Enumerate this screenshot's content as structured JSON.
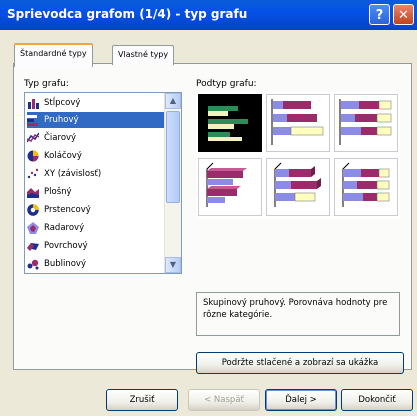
{
  "window": {
    "title": "Sprievodca grafom (1/4) - typ grafu",
    "help_label": "?",
    "close_label": "✕"
  },
  "tabs": [
    {
      "label": "Štandardné typy",
      "active": true
    },
    {
      "label": "Vlastné typy",
      "active": false
    }
  ],
  "chart_type": {
    "label": "Typ grafu:",
    "items": [
      {
        "label": "Stĺpcový",
        "icon": "column-chart-icon"
      },
      {
        "label": "Pruhový",
        "icon": "bar-chart-icon",
        "selected": true
      },
      {
        "label": "Čiarový",
        "icon": "line-chart-icon"
      },
      {
        "label": "Koláčový",
        "icon": "pie-chart-icon"
      },
      {
        "label": "XY (závislosť)",
        "icon": "scatter-chart-icon"
      },
      {
        "label": "Plošný",
        "icon": "area-chart-icon"
      },
      {
        "label": "Prstencový",
        "icon": "doughnut-chart-icon"
      },
      {
        "label": "Radarový",
        "icon": "radar-chart-icon"
      },
      {
        "label": "Povrchový",
        "icon": "surface-chart-icon"
      },
      {
        "label": "Bublinový",
        "icon": "bubble-chart-icon"
      }
    ]
  },
  "subtype": {
    "label": "Podtyp grafu:",
    "options": [
      {
        "icon": "clustered-bar-icon",
        "selected": true
      },
      {
        "icon": "stacked-bar-icon"
      },
      {
        "icon": "100-stacked-bar-icon"
      },
      {
        "icon": "3d-clustered-bar-icon"
      },
      {
        "icon": "3d-stacked-bar-icon"
      },
      {
        "icon": "3d-100-stacked-bar-icon"
      }
    ]
  },
  "description": "Skupinový pruhový. Porovnáva hodnoty pre rôzne kategórie.",
  "preview_button": "Podržte stlačené a zobrazí sa ukážka",
  "buttons": {
    "cancel": "Zrušiť",
    "back": "< Naspäť",
    "next": "Ďalej >",
    "finish": "Dokončiť"
  },
  "colors": {
    "accent": "#316AC5",
    "series1": "#9C2B6C",
    "series2": "#8C8CE6",
    "series3": "#FFFFC0"
  }
}
